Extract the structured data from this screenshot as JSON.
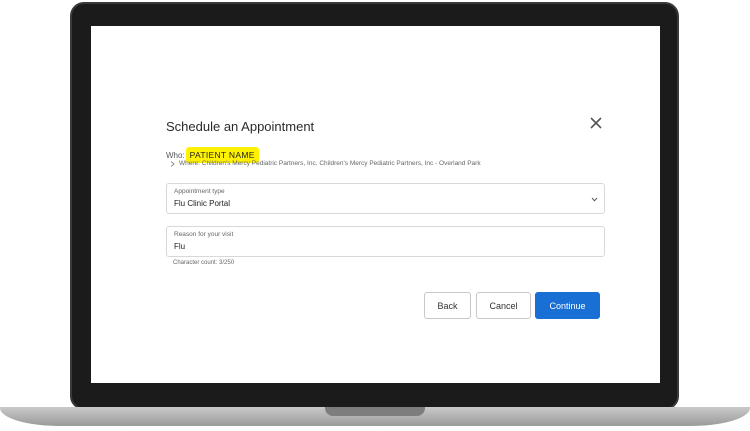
{
  "modal": {
    "title": "Schedule an Appointment",
    "who_label": "Who:",
    "patient_name": "PATIENT NAME",
    "where_text": "Where: Children's Mercy Pediatric Partners, Inc. Children's Mercy Pediatric Partners, Inc - Overland Park"
  },
  "appointment_type": {
    "label": "Appointment type",
    "value": "Flu Clinic Portal"
  },
  "reason": {
    "label": "Reason for your visit",
    "value": "Flu",
    "char_count": "Character count: 3/250"
  },
  "buttons": {
    "back": "Back",
    "cancel": "Cancel",
    "continue": "Continue"
  },
  "colors": {
    "accent": "#1a6fd4",
    "highlight": "#fff200"
  }
}
